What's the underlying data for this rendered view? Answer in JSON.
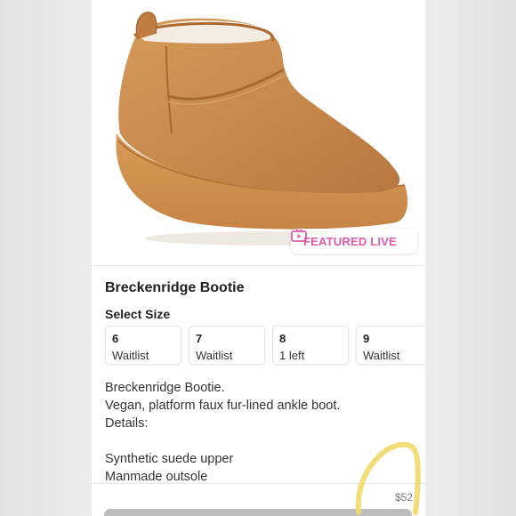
{
  "featured_badge": {
    "label": "FEATURED LIVE",
    "icon": "tv-play-icon",
    "color": "#e35aa9"
  },
  "product": {
    "title": "Breckenridge Bootie",
    "size_heading": "Select Size",
    "sizes": [
      {
        "size": "6",
        "status": "Waitlist"
      },
      {
        "size": "7",
        "status": "Waitlist"
      },
      {
        "size": "8",
        "status": "1 left"
      },
      {
        "size": "9",
        "status": "Waitlist"
      }
    ],
    "description_lines": [
      "Breckenridge Bootie.",
      "Vegan, platform faux fur-lined ankle boot.",
      "Details:",
      "",
      "Synthetic suede upper",
      "Manmade outsole"
    ]
  },
  "footer": {
    "price": "$52"
  },
  "colors": {
    "boot_suede": "#c88a4c",
    "highlight": "#f2d96a"
  }
}
